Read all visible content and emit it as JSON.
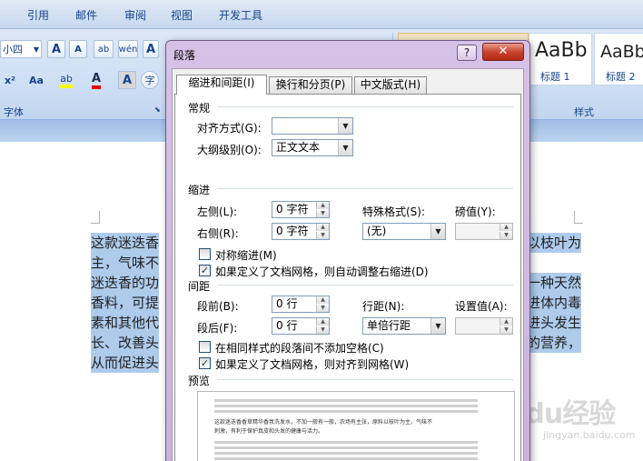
{
  "ribbon": {
    "tabs": [
      "引用",
      "邮件",
      "审阅",
      "视图",
      "开发工具"
    ],
    "font_size": "小四",
    "font_group_label": "字体",
    "styles_group_label": "样式",
    "styles": [
      {
        "preview": "AaBb",
        "name": "标题 1"
      },
      {
        "preview": "AaBb",
        "name": "标题 2"
      }
    ],
    "icons": {
      "grow_font": "A",
      "shrink_font": "A",
      "phonetic": "wén",
      "char_border": "A",
      "superscript": "x²",
      "change_case": "Aa",
      "highlight": "ab",
      "font_color": "A",
      "char_shading": "A",
      "enclose": "字"
    }
  },
  "document": {
    "lines_left": [
      "这款迷迭香",
      "主，气味不",
      "迷迭香的功",
      "香料，可提",
      "素和其他代",
      "长、改善头",
      "从而促进头"
    ],
    "lines_right": [
      "以枝叶为",
      "一种天然",
      "进体内毒",
      "进头发生",
      "的营养，"
    ]
  },
  "watermark": {
    "text": "Baidu经验",
    "sub": "jingyan.baidu.com"
  },
  "dialog": {
    "title": "段落",
    "help": "?",
    "close": "✕",
    "tabs": [
      "缩进和间距(I)",
      "换行和分页(P)",
      "中文版式(H)"
    ],
    "general": {
      "section": "常规",
      "alignment_label": "对齐方式(G):",
      "alignment_value": "",
      "outline_label": "大纲级别(O):",
      "outline_value": "正文文本"
    },
    "indent": {
      "section": "缩进",
      "left_label": "左侧(L):",
      "left_value": "0 字符",
      "right_label": "右侧(R):",
      "right_value": "0 字符",
      "special_label": "特殊格式(S):",
      "special_value": "(无)",
      "by_label": "磅值(Y):",
      "by_value": "",
      "mirror_label": "对称缩进(M)",
      "mirror_checked": false,
      "auto_adjust_label": "如果定义了文档网格，则自动调整右缩进(D)",
      "auto_adjust_checked": true
    },
    "spacing": {
      "section": "间距",
      "before_label": "段前(B):",
      "before_value": "0 行",
      "after_label": "段后(F):",
      "after_value": "0 行",
      "line_label": "行距(N):",
      "line_value": "单倍行距",
      "at_label": "设置值(A):",
      "at_value": "",
      "no_space_label": "在相同样式的段落间不添加空格(C)",
      "no_space_checked": false,
      "snap_grid_label": "如果定义了文档网格，则对齐到网格(W)",
      "snap_grid_checked": true
    },
    "preview": {
      "section": "预览",
      "sample": "这款迷迭香香草精华香氛洗发水，不加一般有一般，农场有主张，原料以枝叶为主，气味不",
      "sample2": "刺激，有利于保护真皮和头发的健康与活力。"
    },
    "checkmark": "✓"
  }
}
